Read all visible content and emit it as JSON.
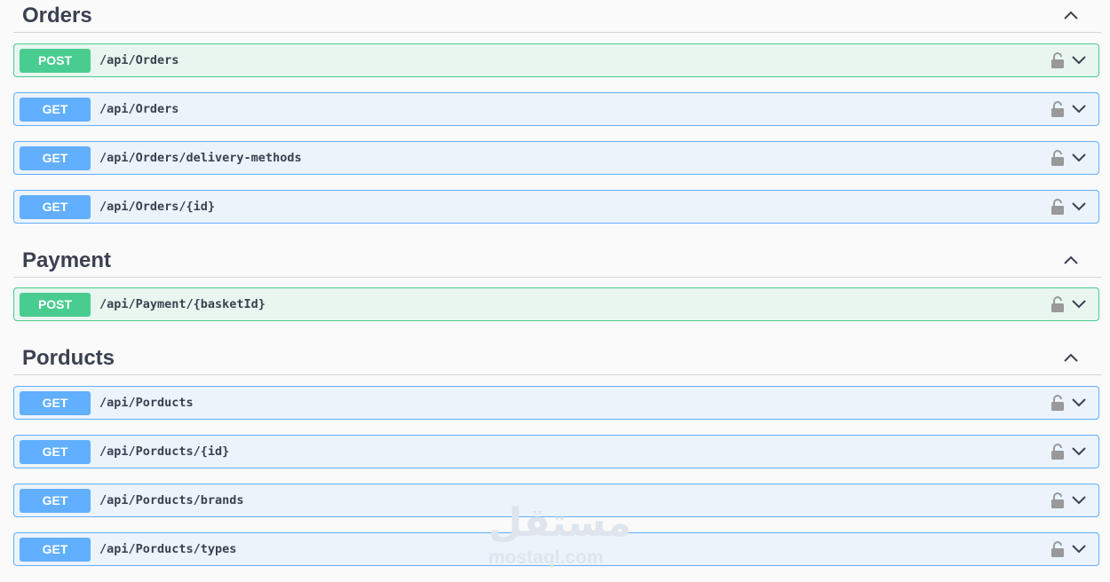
{
  "sections": [
    {
      "title": "Orders",
      "operations": [
        {
          "method": "POST",
          "path": "/api/Orders"
        },
        {
          "method": "GET",
          "path": "/api/Orders"
        },
        {
          "method": "GET",
          "path": "/api/Orders/delivery-methods"
        },
        {
          "method": "GET",
          "path": "/api/Orders/{id}"
        }
      ]
    },
    {
      "title": "Payment",
      "operations": [
        {
          "method": "POST",
          "path": "/api/Payment/{basketId}"
        }
      ]
    },
    {
      "title": "Porducts",
      "operations": [
        {
          "method": "GET",
          "path": "/api/Porducts"
        },
        {
          "method": "GET",
          "path": "/api/Porducts/{id}"
        },
        {
          "method": "GET",
          "path": "/api/Porducts/brands"
        },
        {
          "method": "GET",
          "path": "/api/Porducts/types"
        }
      ]
    }
  ],
  "icons": {
    "collapse": "chevron-up-icon",
    "lock": "lock-icon",
    "expand": "chevron-down-icon"
  },
  "colors": {
    "post": "#49cc90",
    "get": "#61affe"
  },
  "watermark": {
    "script": "مستقل",
    "text": "mostaql.com"
  }
}
